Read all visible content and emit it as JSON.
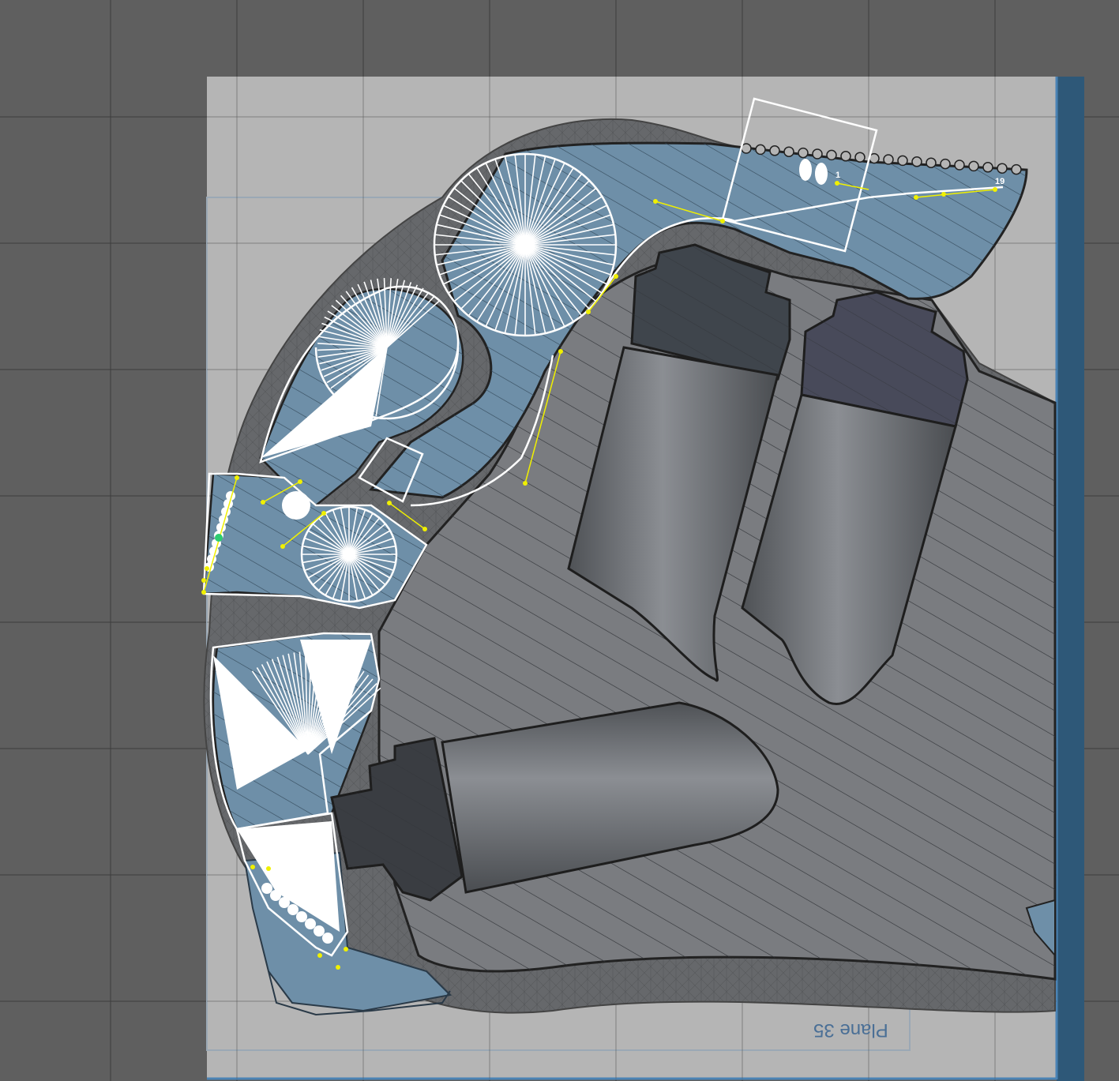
{
  "viewport": {
    "background": "#5f5f5f",
    "plane_fill": "#b5b5b5",
    "grid_line_color": "#3c3c3c",
    "accent_bar": "#2e5878",
    "plane_border": "#4a83b5"
  },
  "plane": {
    "label": "Plane 35"
  },
  "sketch": {
    "point_labels": [
      "1",
      "19"
    ],
    "constraint_color": "#f0f000",
    "profile_color": "#ffffff",
    "selected_point_color": "#2ecc71"
  },
  "model": {
    "section_fill": "#6e8fa8",
    "body_fill": "#7a7c80",
    "mesh_fill": "#6b6d70",
    "dark_part_fill": "#3a3d42",
    "bore_fill": "#5e6064"
  }
}
